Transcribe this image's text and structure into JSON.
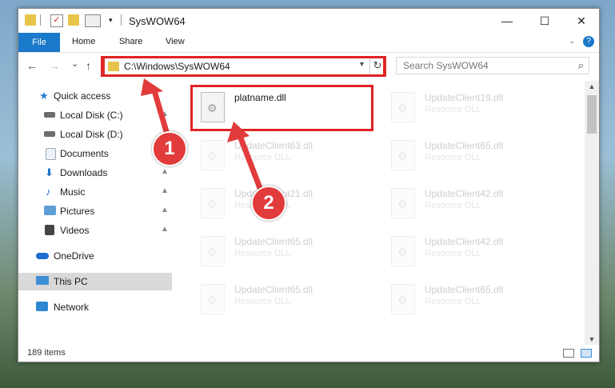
{
  "window": {
    "title": "SysWOW64",
    "controls": {
      "minimize": "—",
      "maximize": "☐",
      "close": "✕"
    }
  },
  "ribbon": {
    "tabs": [
      "File",
      "Home",
      "Share",
      "View"
    ],
    "collapse_icon": "chevron-down-icon",
    "help_icon": "help-icon"
  },
  "nav": {
    "back": "←",
    "forward": "→",
    "recent": "⌄",
    "up": "↑",
    "address": "C:\\Windows\\SysWOW64",
    "refresh": "↻",
    "search_placeholder": "Search SysWOW64"
  },
  "sidebar": {
    "items": [
      {
        "label": "Quick access",
        "icon": "star-icon",
        "color": "#2b7cd3"
      },
      {
        "label": "Local Disk (C:)",
        "icon": "drive-icon",
        "color": "#6d6d6d",
        "pinned": true
      },
      {
        "label": "Local Disk (D:)",
        "icon": "drive-icon",
        "color": "#6d6d6d",
        "pinned": true
      },
      {
        "label": "Documents",
        "icon": "documents-icon",
        "color": "#9aa9b8",
        "pinned": true
      },
      {
        "label": "Downloads",
        "icon": "downloads-icon",
        "color": "#1a73c7",
        "pinned": true
      },
      {
        "label": "Music",
        "icon": "music-icon",
        "color": "#2a6fc4",
        "pinned": true
      },
      {
        "label": "Pictures",
        "icon": "pictures-icon",
        "color": "#5e9ed6",
        "pinned": true
      },
      {
        "label": "Videos",
        "icon": "videos-icon",
        "color": "#444444",
        "pinned": true
      },
      {
        "label": "OneDrive",
        "icon": "onedrive-icon",
        "color": "#1e6fd0"
      },
      {
        "label": "This PC",
        "icon": "pc-icon",
        "color": "#3d8fd6",
        "selected": true
      },
      {
        "label": "Network",
        "icon": "network-icon",
        "color": "#2e86d1"
      }
    ],
    "pin_glyph": "📌"
  },
  "files": [
    {
      "name": "platname.dll",
      "type": "",
      "highlighted": true
    },
    {
      "name": "UpdateClient19.dll",
      "type": "Resource DLL"
    },
    {
      "name": "UpdateClient63.dll",
      "type": "Resource DLL"
    },
    {
      "name": "UpdateClient65.dll",
      "type": "Resource DLL"
    },
    {
      "name": "UpdateClient21.dll",
      "type": "Resource DLL"
    },
    {
      "name": "UpdateClient42.dll",
      "type": "Resource DLL"
    },
    {
      "name": "UpdateClient65.dll",
      "type": "Resource DLL"
    },
    {
      "name": "UpdateClient42.dll",
      "type": "Resource DLL"
    },
    {
      "name": "UpdateClient65.dll",
      "type": "Resource DLL"
    },
    {
      "name": "UpdateClient65.dll",
      "type": "Resource DLL"
    }
  ],
  "status": {
    "count": "189 items"
  },
  "annotations": {
    "step1": "1",
    "step2": "2"
  },
  "colors": {
    "accent": "#1979ca",
    "callout": "#e02222",
    "marker": "#e23b3b"
  }
}
